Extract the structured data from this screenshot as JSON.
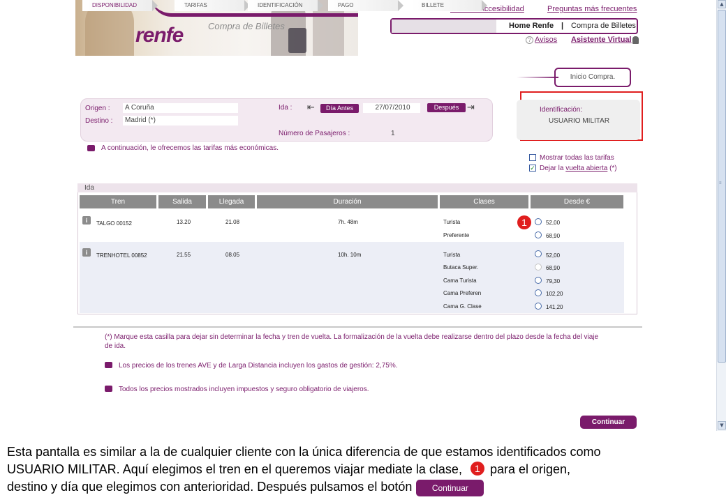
{
  "header": {
    "logo": "renfe",
    "banner_title": "Compra de Billetes",
    "links": {
      "accesibilidad": "Guía de Accesibilidad",
      "faq": "Preguntas más frecuentes"
    },
    "breadcrumb": {
      "home": "Home Renfe",
      "separator": "|",
      "current": "Compra de Billetes"
    },
    "avisos": "Avisos",
    "asistente": "Asistente Virtual"
  },
  "steps": [
    "DISPONIBILIDAD",
    "TARIFAS",
    "IDENTIFICACIÓN",
    "PAGO",
    "BILLETE"
  ],
  "inicio_compra": "Inicio Compra.",
  "search": {
    "origen_label": "Origen :",
    "origen_value": "A Coruña",
    "destino_label": "Destino :",
    "destino_value": "Madrid (*)",
    "ida_label": "Ida :",
    "dia_antes": "Día Antes",
    "fecha": "27/07/2010",
    "despues": "Después",
    "pasajeros_label": "Número de Pasajeros :",
    "pasajeros_value": "1"
  },
  "identificacion": {
    "title": "Identificación:",
    "value": "USUARIO MILITAR"
  },
  "info_line": "A continuación, le ofrecemos las tarifas más económicas.",
  "options": {
    "mostrar_todas": "Mostrar todas las tarifas",
    "dejar_prefix": "Dejar la",
    "dejar_link": "vuelta abierta",
    "dejar_suffix": "(*)"
  },
  "table": {
    "section": "Ida",
    "headers": [
      "Tren",
      "Salida",
      "Llegada",
      "Duración",
      "Clases",
      "Desde €"
    ],
    "trains": [
      {
        "name": "TALGO 00152",
        "salida": "13.20",
        "llegada": "21.08",
        "duracion": "7h. 48m",
        "clases": [
          {
            "clase": "Turista",
            "precio": "52,00"
          },
          {
            "clase": "Preferente",
            "precio": "68,90"
          }
        ]
      },
      {
        "name": "TRENHOTEL 00852",
        "salida": "21.55",
        "llegada": "08.05",
        "duracion": "10h. 10m",
        "clases": [
          {
            "clase": "Turista",
            "precio": "52,00"
          },
          {
            "clase": "Butaca Super.",
            "precio": "68,90"
          },
          {
            "clase": "Cama Turista",
            "precio": "79,30"
          },
          {
            "clase": "Cama Preferen",
            "precio": "102,20"
          },
          {
            "clase": "Cama G. Clase",
            "precio": "141,20"
          }
        ]
      }
    ]
  },
  "marker": "1",
  "notes": {
    "asterisk_line1": "(*) Marque esta casilla para dejar sin determinar la fecha y tren de vuelta. La formalización de la vuelta debe realizarse dentro del plazo desde la fecha del viaje",
    "asterisk_line2": "de ida.",
    "gastos": "Los precios de los trenes AVE y de Larga Distancia incluyen los gastos de gestión: 2,75%.",
    "impuestos": "Todos los precios mostrados incluyen impuestos y seguro obligatorio de viajeros."
  },
  "continuar": "Continuar",
  "caption": {
    "line1": "Esta pantalla es similar a la de cualquier cliente con la única diferencia de que estamos identificados como",
    "line2_a": "USUARIO MILITAR. Aquí elegimos el tren en el queremos viajar mediate la clase,",
    "line2_b": "para el origen,",
    "line3": "destino y día que elegimos con anterioridad. Después pulsamos el botón"
  },
  "colors": {
    "brand": "#7a1b6b",
    "highlight": "#e01e1e",
    "table_header": "#8b8b8b"
  }
}
